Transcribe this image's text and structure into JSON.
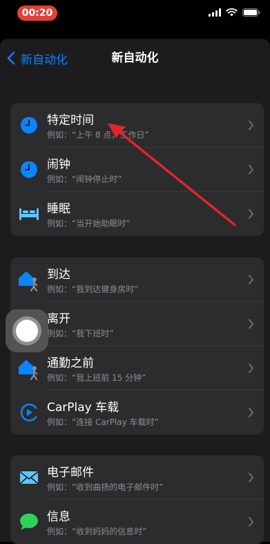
{
  "status": {
    "time": "00:20"
  },
  "nav": {
    "back_label": "新自动化",
    "title": "新自动化"
  },
  "groups": [
    {
      "rows": [
        {
          "title": "特定时间",
          "sub": "例如：“上午 8 点，工作日”",
          "icon": "clock-icon"
        },
        {
          "title": "闹钟",
          "sub": "例如：“闹钟停止时”",
          "icon": "alarm-clock-icon"
        },
        {
          "title": "睡眠",
          "sub": "例如：“当开始助眠时”",
          "icon": "bed-icon"
        }
      ]
    },
    {
      "rows": [
        {
          "title": "到达",
          "sub": "例如：“我到达健身房时”",
          "icon": "home-walk-icon"
        },
        {
          "title": "离开",
          "sub": "例如：“我下班时”",
          "icon": "home-walk-icon"
        },
        {
          "title": "通勤之前",
          "sub": "例如：“我上班前 15 分钟”",
          "icon": "home-walk-icon"
        },
        {
          "title": "CarPlay 车载",
          "sub": "例如：“连接 CarPlay 车载时”",
          "icon": "carplay-icon"
        }
      ]
    },
    {
      "rows": [
        {
          "title": "电子邮件",
          "sub": "例如：“收到曲扬的电子邮件时”",
          "icon": "mail-icon"
        },
        {
          "title": "信息",
          "sub": "例如：“收到妈妈的信息时”",
          "icon": "message-icon"
        }
      ]
    }
  ],
  "colors": {
    "accent": "#0a84ff",
    "time_pill": "#e5403b",
    "bed": "#5ac8fa",
    "message": "#30d158",
    "annotation_arrow": "#e0262a"
  }
}
